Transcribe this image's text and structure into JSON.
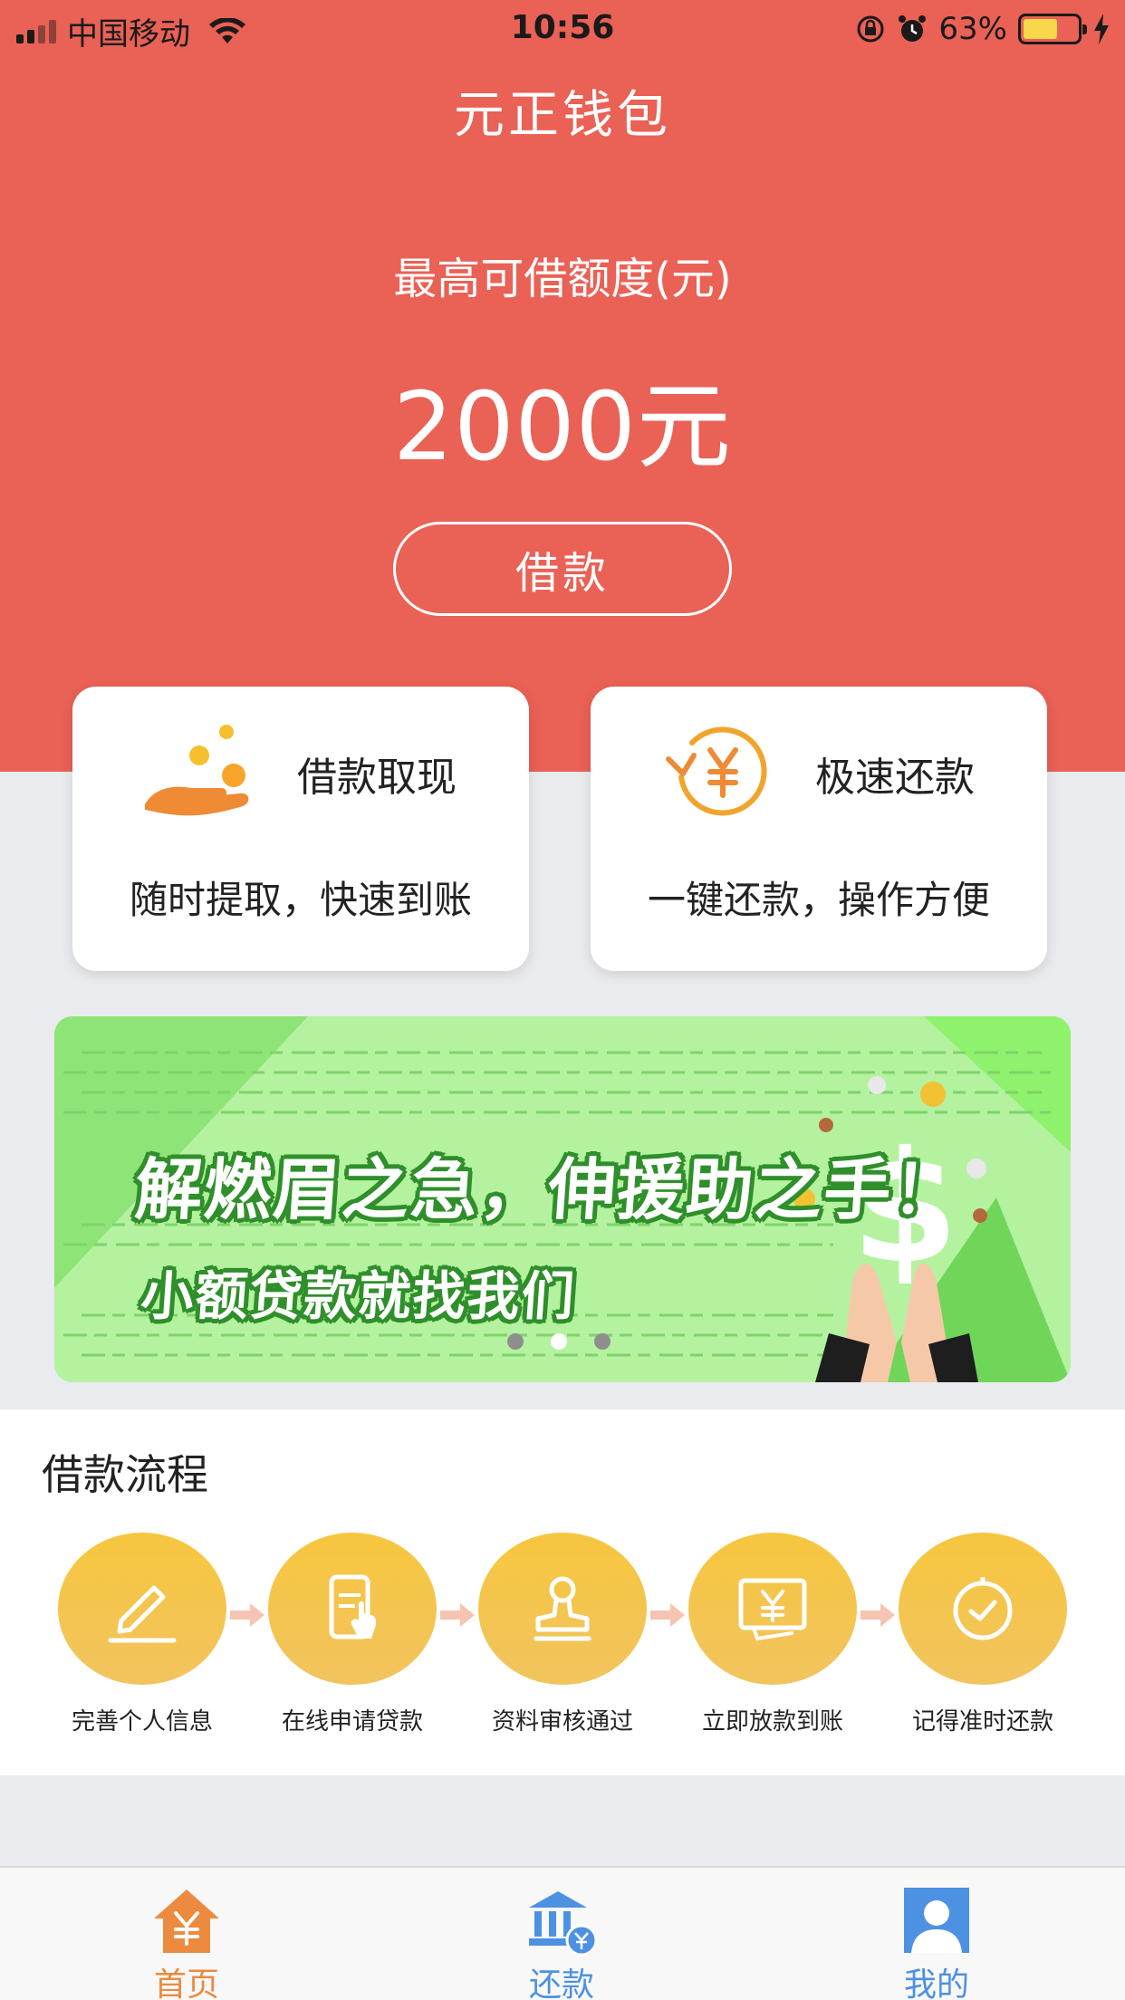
{
  "status_bar": {
    "carrier": "中国移动",
    "time": "10:56",
    "battery_percent": "63%",
    "battery_level": 0.63
  },
  "header": {
    "app_title": "元正钱包",
    "limit_label": "最高可借额度(元)",
    "limit_value": "2000元",
    "borrow_button": "借款"
  },
  "cards": [
    {
      "title": "借款取现",
      "subtitle": "随时提取，快速到账",
      "icon": "hand-coins-icon"
    },
    {
      "title": "极速还款",
      "subtitle": "一键还款，操作方便",
      "icon": "yuan-refresh-icon"
    }
  ],
  "banner": {
    "headline": "解燃眉之急，伸援助之手！",
    "subheadline": "小额贷款就找我们",
    "page_count": 3,
    "active_page": 2
  },
  "process": {
    "title": "借款流程",
    "steps": [
      {
        "label": "完善个人信息",
        "icon": "pen-icon"
      },
      {
        "label": "在线申请贷款",
        "icon": "phone-tap-icon"
      },
      {
        "label": "资料审核通过",
        "icon": "stamp-icon"
      },
      {
        "label": "立即放款到账",
        "icon": "yuan-screen-icon"
      },
      {
        "label": "记得准时还款",
        "icon": "clock-icon"
      }
    ]
  },
  "tabbar": {
    "tabs": [
      {
        "label": "首页",
        "icon": "home-yuan-icon",
        "active": true
      },
      {
        "label": "还款",
        "icon": "bank-icon",
        "active": false
      },
      {
        "label": "我的",
        "icon": "profile-icon",
        "active": false
      }
    ]
  },
  "colors": {
    "hero_red": "#ea6155",
    "step_yellow": "#f7c63e",
    "home_orange": "#ec8a3f",
    "tab_blue": "#4d91e3",
    "banner_green": "#b2f19d"
  }
}
